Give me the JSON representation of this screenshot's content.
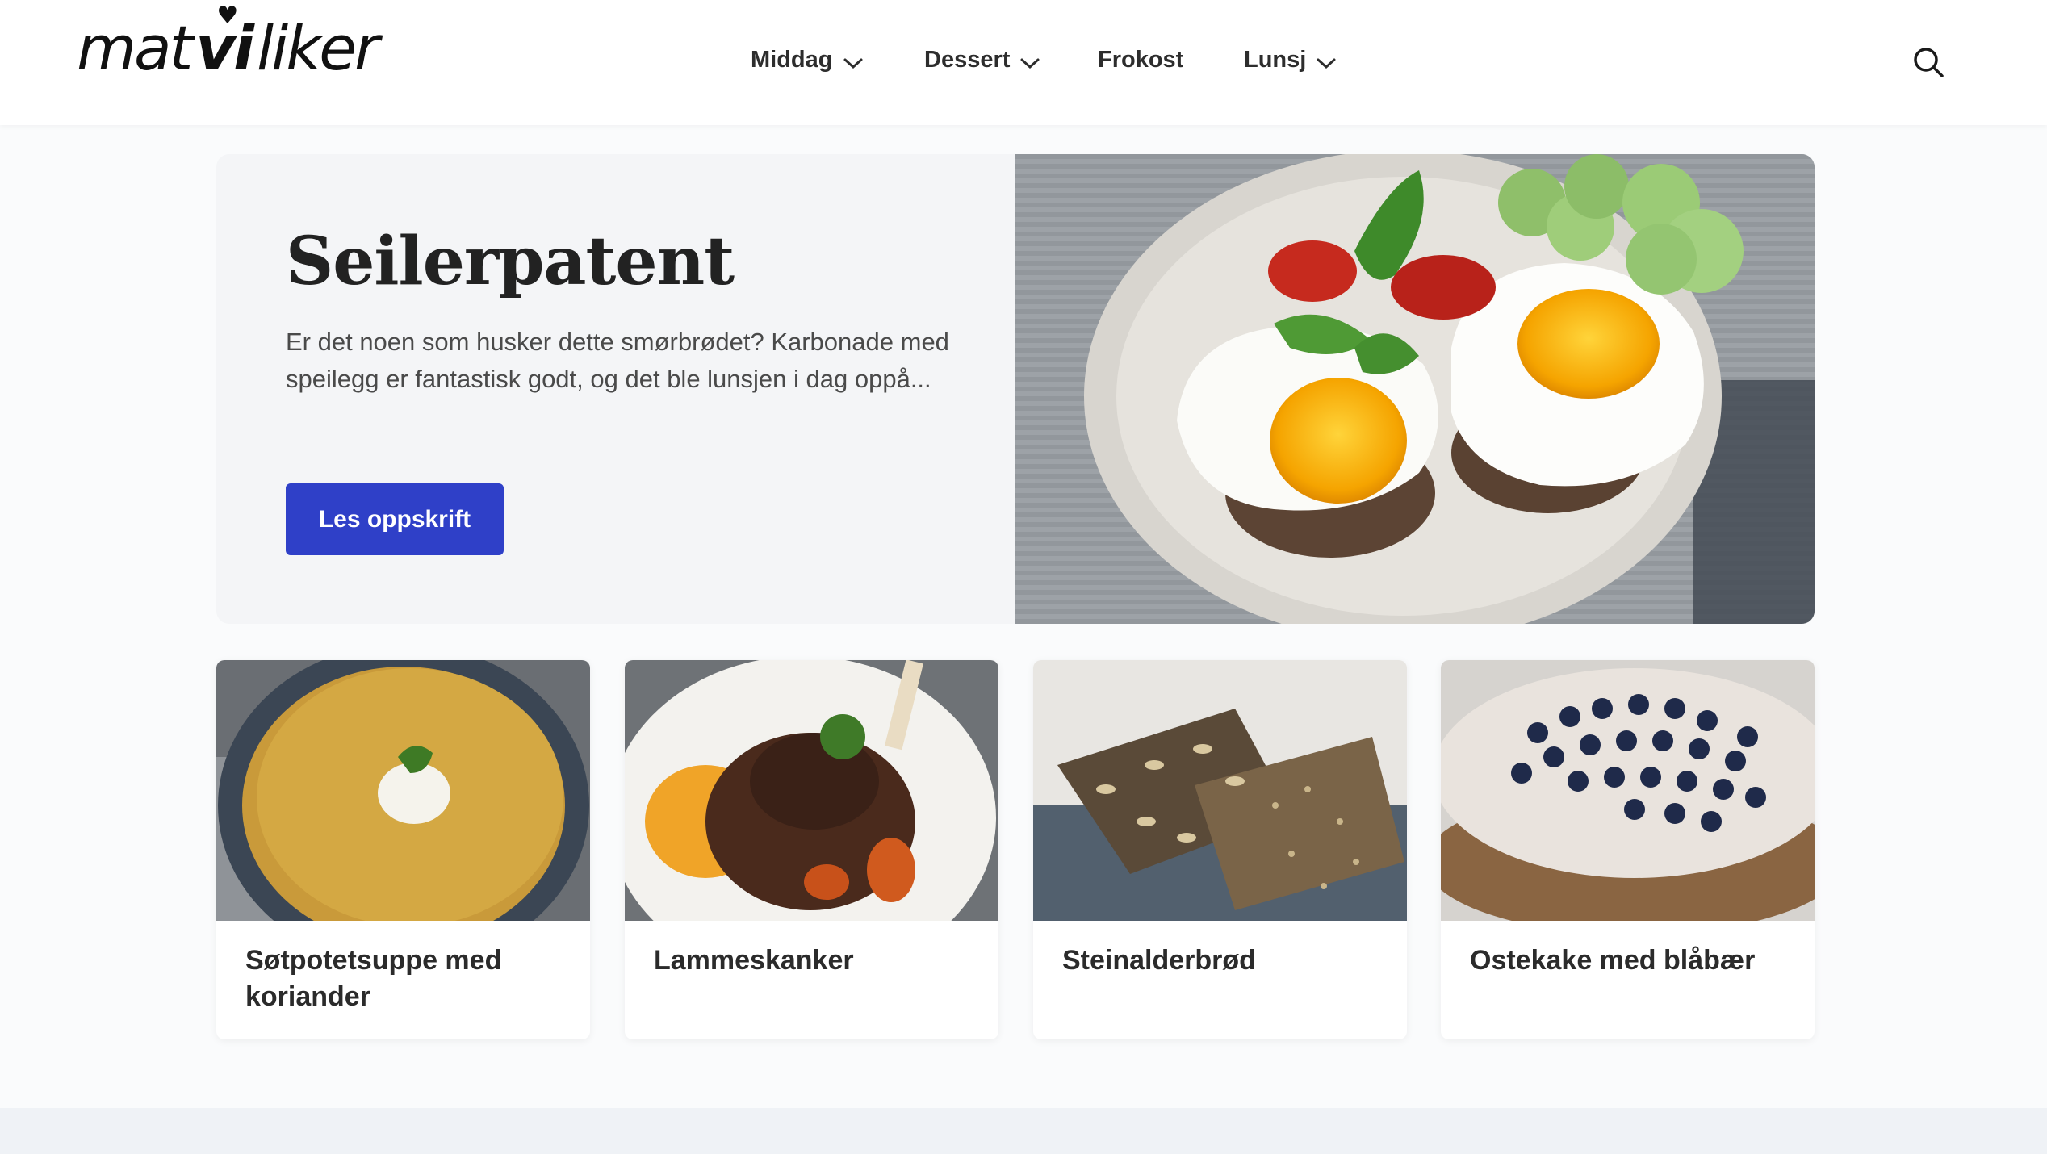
{
  "header": {
    "logo": {
      "part1": "mat",
      "part2": "vi",
      "part3": "liker"
    },
    "nav": [
      {
        "label": "Middag",
        "has_dropdown": true
      },
      {
        "label": "Dessert",
        "has_dropdown": true
      },
      {
        "label": "Frokost",
        "has_dropdown": false
      },
      {
        "label": "Lunsj",
        "has_dropdown": true
      }
    ],
    "search_icon": "search-icon"
  },
  "hero": {
    "title": "Seilerpatent",
    "description": "Er det noen som husker dette smørbrødet? Karbonade med speilegg er fantastisk godt, og det ble lunsjen i dag oppå...",
    "button_label": "Les oppskrift"
  },
  "cards": [
    {
      "title": "Søtpotetsuppe med koriander"
    },
    {
      "title": "Lammeskanker"
    },
    {
      "title": "Steinalderbrød"
    },
    {
      "title": "Ostekake med blåbær"
    }
  ],
  "colors": {
    "accent": "#2f40c8",
    "page_background": "#fafbfc",
    "hero_background": "#f4f5f7"
  }
}
